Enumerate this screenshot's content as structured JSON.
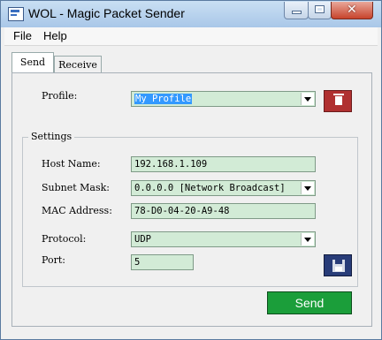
{
  "window": {
    "title": "WOL - Magic Packet Sender"
  },
  "menu": {
    "items": [
      {
        "label": "File"
      },
      {
        "label": "Help"
      }
    ]
  },
  "tabs": [
    {
      "label": "Send",
      "selected": true
    },
    {
      "label": "Receive",
      "selected": false
    }
  ],
  "profile": {
    "label": "Profile:",
    "value": "My Profile"
  },
  "settings": {
    "title": "Settings",
    "host_name": {
      "label": "Host Name:",
      "value": "192.168.1.109"
    },
    "subnet_mask": {
      "label": "Subnet Mask:",
      "value": "0.0.0.0 [Network Broadcast]"
    },
    "mac_address": {
      "label": "MAC Address:",
      "value": "78-D0-04-20-A9-48"
    },
    "protocol": {
      "label": "Protocol:",
      "value": "UDP"
    },
    "port": {
      "label": "Port:",
      "value": "5"
    }
  },
  "buttons": {
    "send_label": "Send"
  },
  "colors": {
    "field_bg": "#d2ebd6",
    "send_button": "#1b9e3a",
    "delete_button": "#b03030",
    "save_button": "#283c78"
  }
}
